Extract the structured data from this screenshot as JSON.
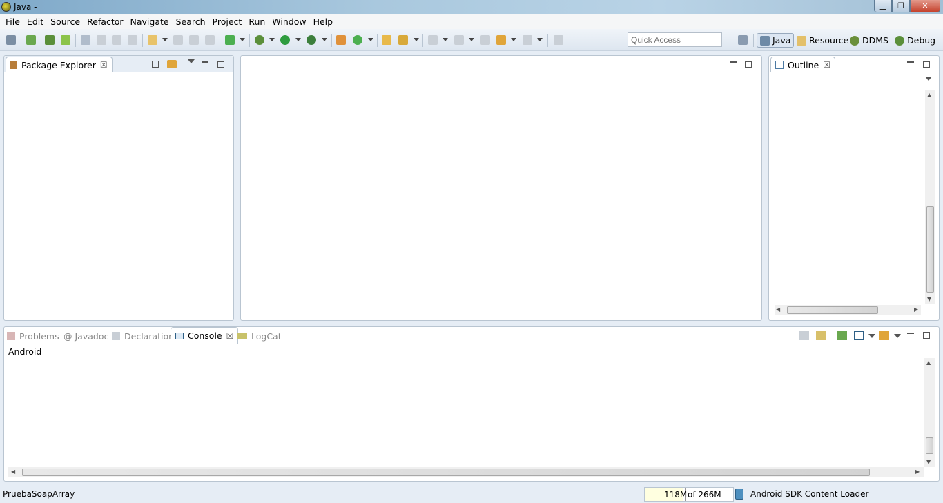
{
  "window": {
    "title": "Java -"
  },
  "menu": [
    "File",
    "Edit",
    "Source",
    "Refactor",
    "Navigate",
    "Search",
    "Project",
    "Run",
    "Window",
    "Help"
  ],
  "toolbar": {
    "quick_access_placeholder": "Quick Access"
  },
  "perspectives": [
    {
      "label": "Java",
      "icon": "java-perspective-icon",
      "active": true
    },
    {
      "label": "Resource",
      "icon": "resource-perspective-icon",
      "active": false
    },
    {
      "label": "DDMS",
      "icon": "ddms-perspective-icon",
      "active": false
    },
    {
      "label": "Debug",
      "icon": "debug-perspective-icon",
      "active": false
    }
  ],
  "left_panel": {
    "tab": "Package Explorer"
  },
  "right_panel": {
    "tab": "Outline"
  },
  "bottom_panel": {
    "tabs": [
      {
        "label": "Problems",
        "active": false
      },
      {
        "label": "Javadoc",
        "active": false
      },
      {
        "label": "Declaration",
        "active": false
      },
      {
        "label": "Console",
        "active": true
      },
      {
        "label": "LogCat",
        "active": false
      }
    ],
    "console_name": "Android"
  },
  "status": {
    "project": "PruebaSoapArray",
    "heap_used": "118M",
    "heap_total": "of 266M",
    "heap_fraction": 0.44,
    "task": "Android SDK Content Loader"
  },
  "colors": {
    "accent": "#4d8fbf",
    "panel_border": "#b9c5d1"
  }
}
